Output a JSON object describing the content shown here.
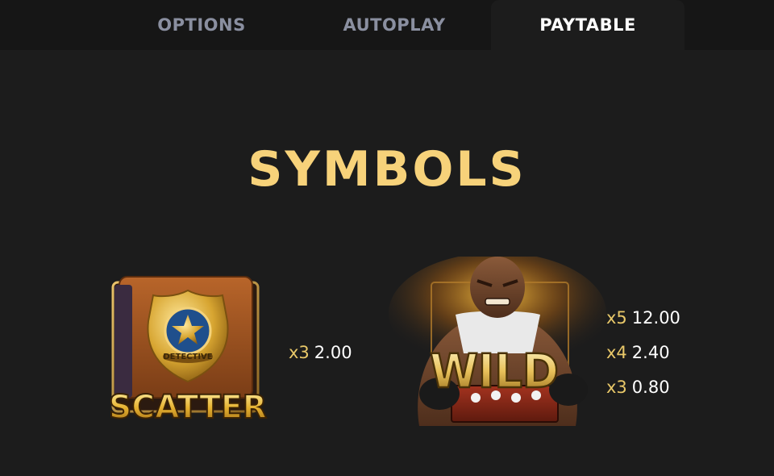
{
  "tabs": [
    {
      "label": "OPTIONS",
      "active": false
    },
    {
      "label": "AUTOPLAY",
      "active": false
    },
    {
      "label": "PAYTABLE",
      "active": true
    }
  ],
  "section_title": "SYMBOLS",
  "symbols": [
    {
      "name": "scatter",
      "badge_text": "DETECTIVE",
      "label": "SCATTER",
      "pays": [
        {
          "mult": "x3",
          "value": "2.00"
        }
      ]
    },
    {
      "name": "wild",
      "label": "WILD",
      "pays": [
        {
          "mult": "x5",
          "value": "12.00"
        },
        {
          "mult": "x4",
          "value": "2.40"
        },
        {
          "mult": "x3",
          "value": "0.80"
        }
      ]
    }
  ],
  "colors": {
    "accent_gold": "#f7d27a",
    "multiplier_gold": "#e9c869",
    "background": "#1c1c1c",
    "tab_inactive": "#8a8fa0"
  }
}
